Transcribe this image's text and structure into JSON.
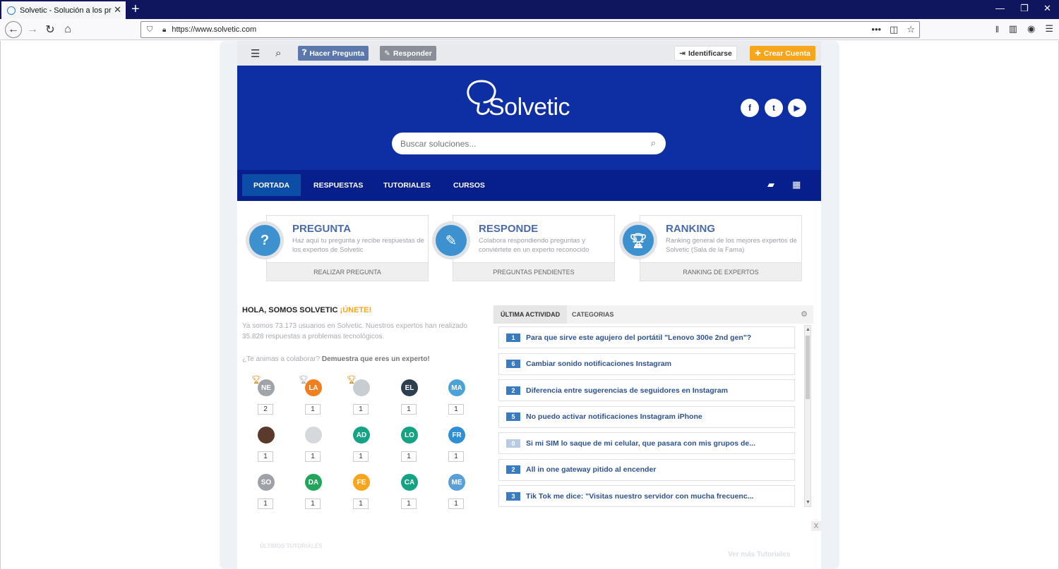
{
  "browser": {
    "tab_title": "Solvetic - Solución a los proble",
    "url": "https://www.solvetic.com"
  },
  "topbar": {
    "ask_label": "Hacer Pregunta",
    "answer_label": "Responder",
    "login_label": "Identificarse",
    "signup_label": "Crear Cuenta"
  },
  "hero": {
    "logo_text": "Solvetic",
    "search_placeholder": "Buscar soluciones...",
    "social": [
      "facebook-icon",
      "twitter-icon",
      "youtube-icon"
    ]
  },
  "nav": {
    "items": [
      "PORTADA",
      "RESPUESTAS",
      "TUTORIALES",
      "CURSOS"
    ]
  },
  "cards": [
    {
      "title": "PREGUNTA",
      "desc": "Haz aquí tu pregunta y recibe respuestas de los expertos de Solvetic",
      "footer": "REALIZAR PREGUNTA",
      "icon": "question-icon"
    },
    {
      "title": "RESPONDE",
      "desc": "Colabora respondiendo preguntas y conviértete en un experto reconocido",
      "footer": "PREGUNTAS PENDIENTES",
      "icon": "pencil-icon"
    },
    {
      "title": "RANKING",
      "desc": "Ranking general de los mejores expertos de Solvetic (Sala de la Fama)",
      "footer": "RANKING DE EXPERTOS",
      "icon": "trophy-icon"
    }
  ],
  "about": {
    "heading": "HOLA, SOMOS SOLVETIC",
    "join": "¡ÚNETE!",
    "intro": "Ya somos 73.173 usuarios en Solvetic. Nuestros expertos han realizado 35.828 respuestas a problemas tecnológicos.",
    "cta_prefix": "¿Te animas a colaborar?",
    "cta_bold": "Demuestra que eres un experto!"
  },
  "experts": [
    {
      "initials": "NE",
      "color": "#a0a4aa",
      "count": "2"
    },
    {
      "initials": "LA",
      "color": "#f07f1e",
      "count": "1"
    },
    {
      "initials": "",
      "color": "#c8cdd2",
      "count": "1"
    },
    {
      "initials": "EL",
      "color": "#2c3e50",
      "count": "1"
    },
    {
      "initials": "MA",
      "color": "#4aa3d8",
      "count": "1"
    },
    {
      "initials": "",
      "color": "#5a3a2a",
      "count": "1"
    },
    {
      "initials": "",
      "color": "#d5d8dc",
      "count": "1"
    },
    {
      "initials": "AD",
      "color": "#16a383",
      "count": "1"
    },
    {
      "initials": "LO",
      "color": "#16a383",
      "count": "1"
    },
    {
      "initials": "FR",
      "color": "#2f8fd6",
      "count": "1"
    },
    {
      "initials": "SO",
      "color": "#9ea2a8",
      "count": "1"
    },
    {
      "initials": "DA",
      "color": "#22a45a",
      "count": "1"
    },
    {
      "initials": "FE",
      "color": "#f7a51b",
      "count": "1"
    },
    {
      "initials": "CA",
      "color": "#16a383",
      "count": "1"
    },
    {
      "initials": "ME",
      "color": "#5aa0d8",
      "count": "1"
    }
  ],
  "activity": {
    "tab_latest": "ÚLTIMA ACTIVIDAD",
    "tab_categories": "CATEGORIAS",
    "items": [
      {
        "count": "1",
        "text": "Para que sirve este agujero del portátil \"Lenovo 300e 2nd gen\"?"
      },
      {
        "count": "6",
        "text": "Cambiar sonido notificaciones Instagram"
      },
      {
        "count": "2",
        "text": "Diferencia entre sugerencias de seguidores en Instagram"
      },
      {
        "count": "5",
        "text": "No puedo activar notificaciones Instagram iPhone"
      },
      {
        "count": "0",
        "text": "Si mi SIM lo saque de mi celular, que pasara con mis grupos de..."
      },
      {
        "count": "2",
        "text": "All in one gateway pitido al encender"
      },
      {
        "count": "3",
        "text": "Tik Tok me dice: \"Visitas nuestro servidor con mucha frecuenc..."
      }
    ]
  },
  "footer_faint": {
    "latest_tutorials": "ÚLTIMOS TUTORIALES",
    "more_tutorials": "Ver más Tutoriales"
  },
  "colors": {
    "hero_bg": "#0d2fa3",
    "nav_bg": "#071f8a",
    "accent_orange": "#f7a51b",
    "card_title": "#4a6aa8"
  }
}
